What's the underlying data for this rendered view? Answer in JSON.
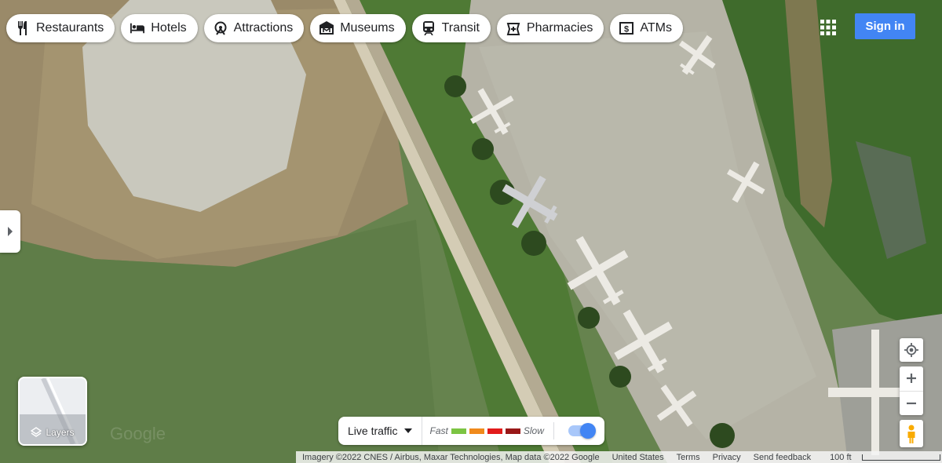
{
  "chips": [
    {
      "label": "Restaurants",
      "icon": "restaurant-icon"
    },
    {
      "label": "Hotels",
      "icon": "hotel-icon"
    },
    {
      "label": "Attractions",
      "icon": "attractions-icon"
    },
    {
      "label": "Museums",
      "icon": "museum-icon"
    },
    {
      "label": "Transit",
      "icon": "transit-icon"
    },
    {
      "label": "Pharmacies",
      "icon": "pharmacy-icon"
    },
    {
      "label": "ATMs",
      "icon": "atm-icon"
    }
  ],
  "header": {
    "signin_label": "Sign in",
    "apps_icon": "apps-grid-icon"
  },
  "layers": {
    "label": "Layers"
  },
  "traffic": {
    "label": "Live traffic",
    "fast_label": "Fast",
    "slow_label": "Slow",
    "scale_colors": [
      "#7cc443",
      "#f08a1c",
      "#e21b1b",
      "#991818"
    ],
    "toggle_on": true
  },
  "footer": {
    "attribution": "Imagery ©2022 CNES / Airbus, Maxar Technologies, Map data ©2022 Google",
    "region": "United States",
    "terms": "Terms",
    "privacy": "Privacy",
    "feedback": "Send feedback",
    "scale_label": "100 ft"
  },
  "colors": {
    "accent": "#4285f4"
  }
}
